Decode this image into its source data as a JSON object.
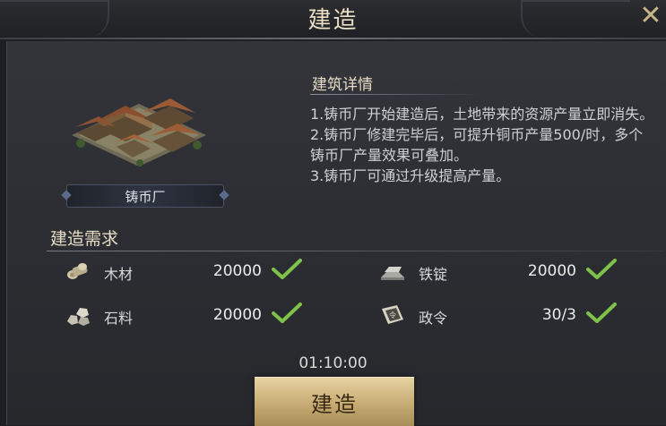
{
  "header": {
    "title": "建造",
    "close_icon": "close-icon"
  },
  "building": {
    "name": "铸币厂",
    "art_icon": "mint-building-art"
  },
  "details": {
    "title": "建筑详情",
    "lines": [
      "1.铸币厂开始建造后，土地带来的资源产量立即消失。",
      "2.铸币厂修建完毕后，可提升铜币产量500/时，多个铸币厂产量效果可叠加。",
      "3.铸币厂可通过升级提高产量。"
    ]
  },
  "requirements": {
    "title": "建造需求",
    "items": [
      {
        "name": "木材",
        "amount": "20000",
        "icon": "wood-icon",
        "met": true
      },
      {
        "name": "铁锭",
        "amount": "20000",
        "icon": "iron-ingot-icon",
        "met": true
      },
      {
        "name": "石料",
        "amount": "20000",
        "icon": "stone-icon",
        "met": true
      },
      {
        "name": "政令",
        "amount": "30/3",
        "icon": "decree-icon",
        "met": true
      }
    ]
  },
  "timer": "01:10:00",
  "build_button": "建造",
  "colors": {
    "check": "#7fc24a",
    "button": "#d4bb85",
    "panel": "#2e3035"
  }
}
